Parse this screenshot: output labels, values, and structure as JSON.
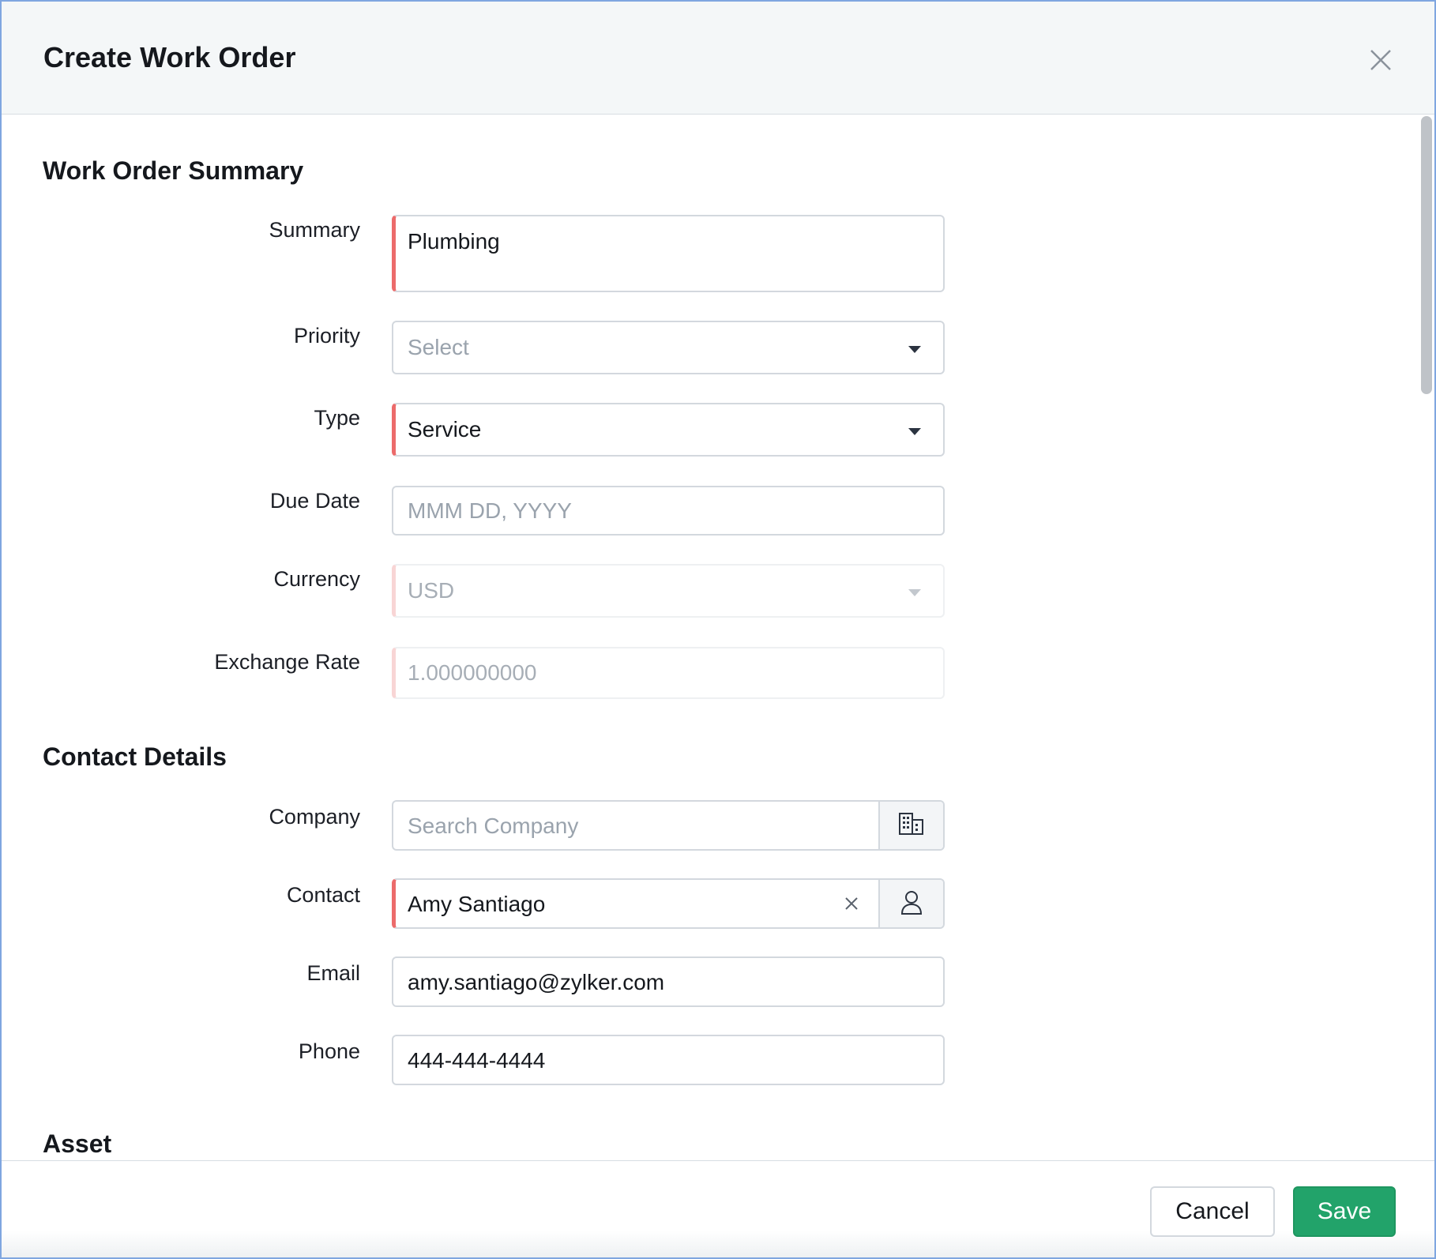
{
  "dialog": {
    "title": "Create Work Order"
  },
  "sections": {
    "summary_title": "Work Order Summary",
    "contact_title": "Contact Details",
    "asset_title": "Asset"
  },
  "fields": {
    "summary": {
      "label": "Summary",
      "value": "Plumbing"
    },
    "priority": {
      "label": "Priority",
      "placeholder": "Select"
    },
    "type": {
      "label": "Type",
      "value": "Service"
    },
    "due_date": {
      "label": "Due Date",
      "placeholder": "MMM DD, YYYY"
    },
    "currency": {
      "label": "Currency",
      "value": "USD"
    },
    "exchange_rate": {
      "label": "Exchange Rate",
      "value": "1.000000000"
    },
    "company": {
      "label": "Company",
      "placeholder": "Search Company"
    },
    "contact": {
      "label": "Contact",
      "value": "Amy Santiago"
    },
    "email": {
      "label": "Email",
      "value": "amy.santiago@zylker.com"
    },
    "phone": {
      "label": "Phone",
      "value": "444-444-4444"
    }
  },
  "footer": {
    "cancel_label": "Cancel",
    "save_label": "Save"
  },
  "colors": {
    "required_marker": "#ec6b6b",
    "save_button": "#22a36a",
    "header_bg": "#f4f7f8"
  },
  "icons": {
    "close": "close-icon",
    "dropdown": "chevron-down-icon",
    "company_lookup": "building-icon",
    "contact_lookup": "user-icon",
    "clear": "clear-icon"
  }
}
